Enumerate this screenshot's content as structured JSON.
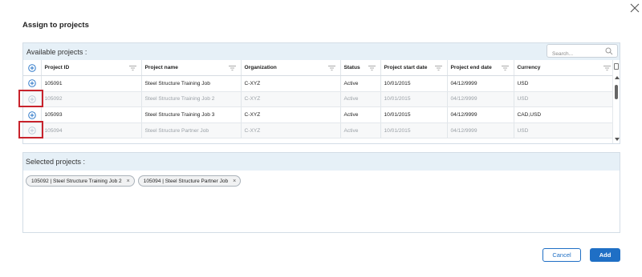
{
  "dialog": {
    "title": "Assign to projects",
    "close_icon": "close-icon"
  },
  "available": {
    "label": "Available projects :",
    "search_placeholder": "Search...",
    "columns": [
      "Project ID",
      "Project name",
      "Organization",
      "Status",
      "Project start date",
      "Project end date",
      "Currency"
    ],
    "rows": [
      {
        "id": "105091",
        "name": "Steel Structure Training Job",
        "org": "C-XYZ",
        "status": "Active",
        "start": "10/01/2015",
        "end": "04/12/9999",
        "currency": "USD",
        "selected": false
      },
      {
        "id": "105092",
        "name": "Steel Structure Training Job 2",
        "org": "C-XYZ",
        "status": "Active",
        "start": "10/01/2015",
        "end": "04/12/9999",
        "currency": "USD",
        "selected": true
      },
      {
        "id": "105093",
        "name": "Steel Structure Training Job 3",
        "org": "C-XYZ",
        "status": "Active",
        "start": "10/01/2015",
        "end": "04/12/9999",
        "currency": "CAD,USD",
        "selected": false
      },
      {
        "id": "105094",
        "name": "Steel Structure Partner Job",
        "org": "C-XYZ",
        "status": "Active",
        "start": "10/01/2015",
        "end": "04/12/9999",
        "currency": "USD",
        "selected": true
      }
    ]
  },
  "selected": {
    "label": "Selected projects :",
    "chips": [
      {
        "label": "105092 | Steel Structure Training Job 2"
      },
      {
        "label": "105094 | Steel Structure Partner Job"
      }
    ]
  },
  "buttons": {
    "cancel": "Cancel",
    "add": "Add"
  },
  "colors": {
    "accent": "#1f6fc5",
    "header_bg": "#e6f0f7",
    "highlight": "#c8232c"
  }
}
